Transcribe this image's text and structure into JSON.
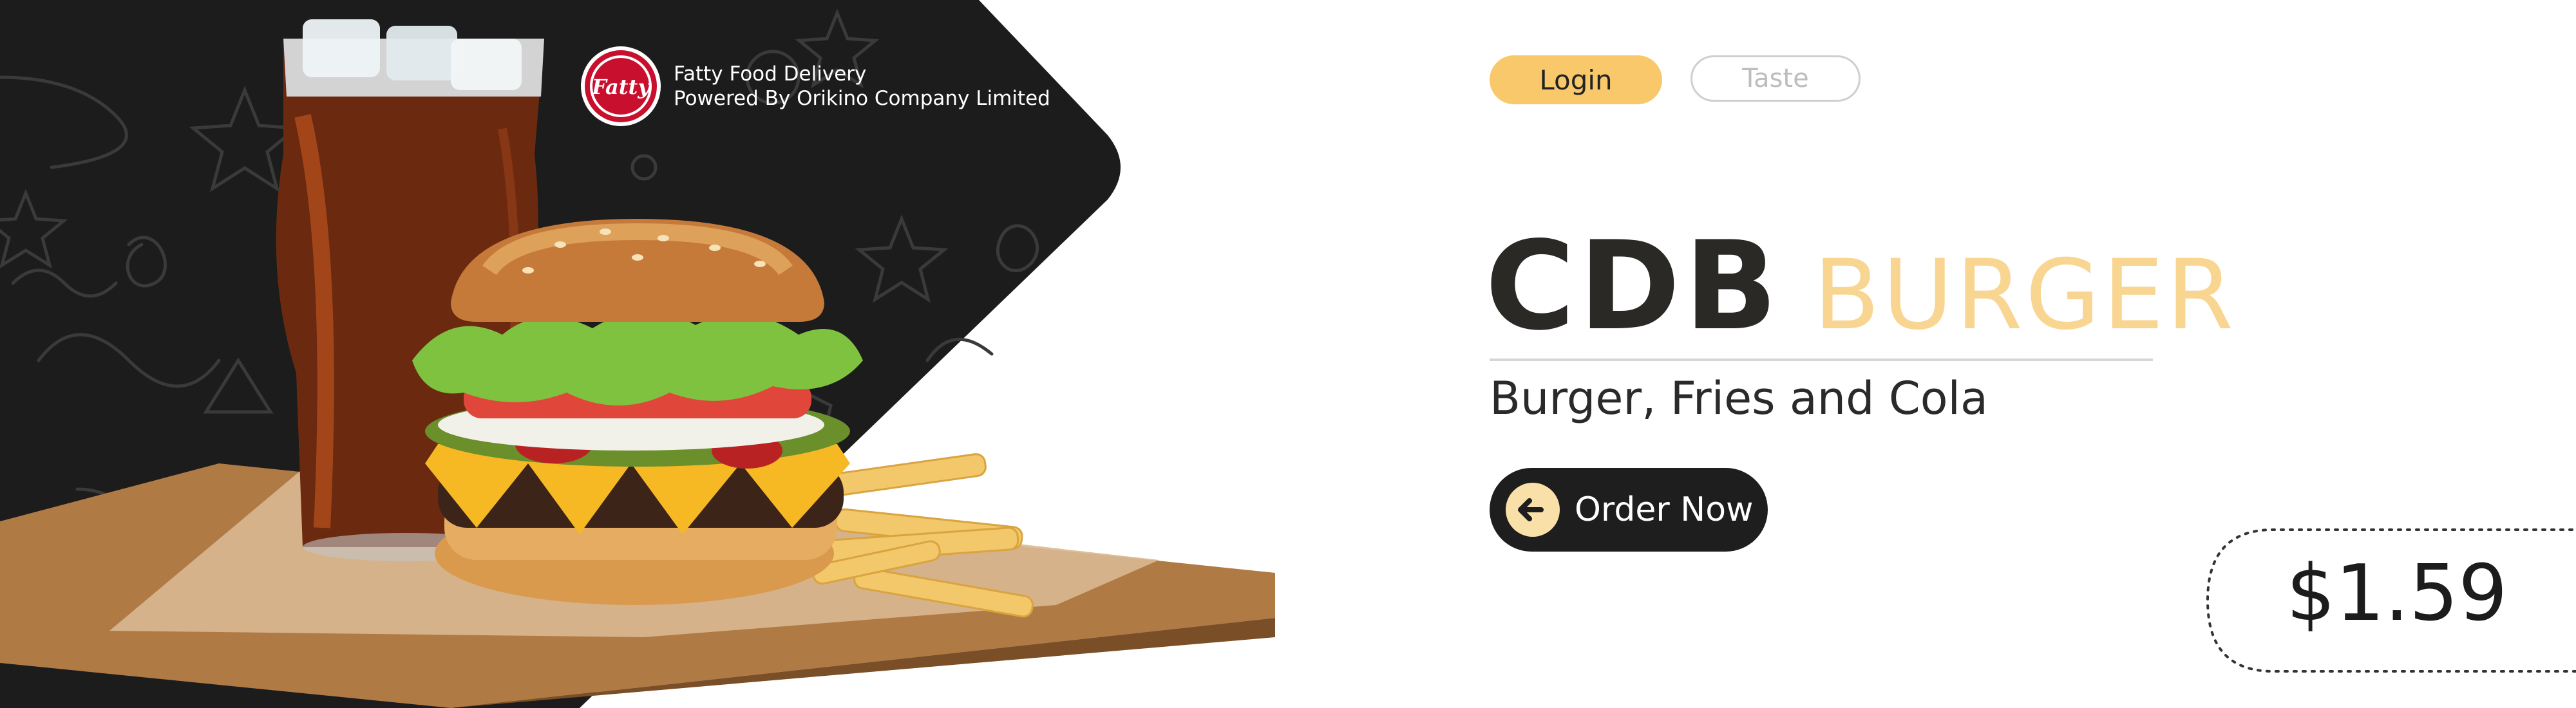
{
  "brand": {
    "logo_text": "Fatty",
    "name": "Fatty Food Delivery",
    "powered_by": "Powered By Orikino Company Limited"
  },
  "nav": {
    "login_label": "Login",
    "taste_label": "Taste"
  },
  "product": {
    "title_main": "CDB",
    "title_accent": "BURGER",
    "subtitle": "Burger, Fries and Cola"
  },
  "cta": {
    "order_label": "Order Now"
  },
  "price": {
    "value": "$1.59"
  },
  "colors": {
    "accent": "#f8c86a",
    "accent_light": "#f9d592",
    "dark": "#1e1e1e",
    "brand_red": "#c8102e"
  },
  "icons": [
    "arrow-left-icon",
    "fatty-logo-icon"
  ]
}
